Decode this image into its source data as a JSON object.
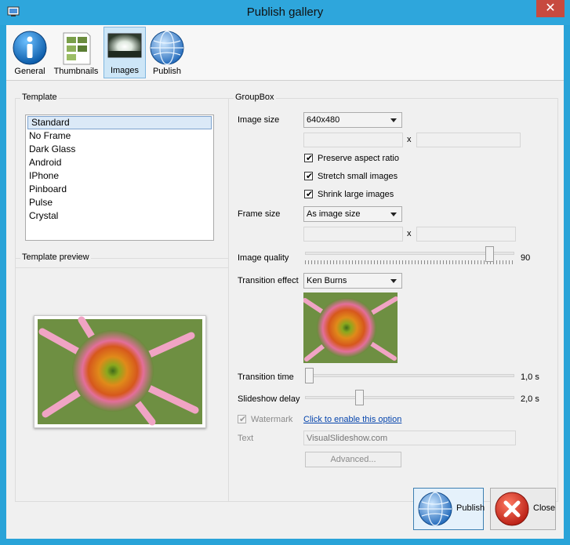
{
  "window": {
    "title": "Publish gallery",
    "close_glyph": "✕"
  },
  "toolbar": {
    "items": [
      {
        "label": "General",
        "icon": "info-icon"
      },
      {
        "label": "Thumbnails",
        "icon": "thumbnails-icon"
      },
      {
        "label": "Images",
        "icon": "image-icon"
      },
      {
        "label": "Publish",
        "icon": "globe-icon"
      }
    ],
    "active": "Images"
  },
  "template": {
    "title": "Template",
    "items": [
      "Standard",
      "No Frame",
      "Dark Glass",
      "Android",
      "IPhone",
      "Pinboard",
      "Pulse",
      "Crystal"
    ],
    "selected": "Standard"
  },
  "preview": {
    "title": "Template preview"
  },
  "groupbox": {
    "title": "GroupBox",
    "image_size": {
      "label": "Image size",
      "value": "640x480",
      "width": "",
      "height": "",
      "x": "x"
    },
    "preserve_aspect": {
      "label": "Preserve aspect ratio",
      "checked": true
    },
    "stretch_small": {
      "label": "Stretch small images",
      "checked": true
    },
    "shrink_large": {
      "label": "Shrink large images",
      "checked": true
    },
    "frame_size": {
      "label": "Frame size",
      "value": "As image size",
      "width": "",
      "height": "",
      "x": "x"
    },
    "image_quality": {
      "label": "Image quality",
      "value": "90",
      "level": 90
    },
    "transition_effect": {
      "label": "Transition effect",
      "value": "Ken Burns"
    },
    "transition_time": {
      "label": "Transition time",
      "value": "1,0 s",
      "level": 1.0
    },
    "slideshow_delay": {
      "label": "Slideshow delay",
      "value": "2,0 s",
      "level": 2.0
    },
    "watermark": {
      "label": "Watermark",
      "checked": true,
      "link": "Click to enable this option"
    },
    "text": {
      "label": "Text",
      "placeholder": "VisualSlideshow.com"
    },
    "advanced": "Advanced..."
  },
  "footer": {
    "publish": "Publish",
    "close": "Close"
  },
  "colors": {
    "titlebar": "#2ea6dc",
    "selection": "#cde6f7",
    "link": "#0645ad",
    "close_red": "#c74a3f"
  }
}
